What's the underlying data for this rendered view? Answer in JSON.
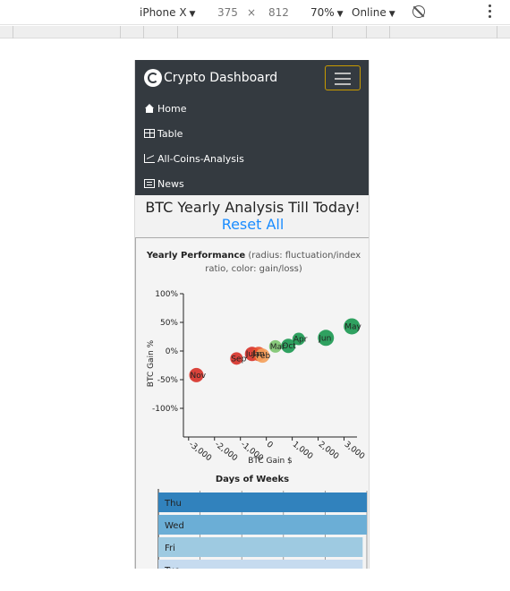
{
  "devtools": {
    "device": "iPhone X",
    "width": "375",
    "times": "×",
    "height": "812",
    "zoom": "70%",
    "network": "Online"
  },
  "nav": {
    "brand": "Crypto Dashboard",
    "links": [
      {
        "label": "Home",
        "icon": "home-icon"
      },
      {
        "label": "Table",
        "icon": "table-icon"
      },
      {
        "label": "All-Coins-Analysis",
        "icon": "chart-icon"
      },
      {
        "label": "News",
        "icon": "news-icon"
      }
    ]
  },
  "page": {
    "title": "BTC Yearly Analysis Till Today!",
    "reset": "Reset All"
  },
  "card": {
    "title": "Yearly Performance",
    "subtitle": " (radius: fluctuation/index ratio, color: gain/loss)"
  },
  "colors": {
    "navbar": "#343a40",
    "link": "#1a8cff",
    "toggler_border": "#c79a00"
  },
  "chart_data": [
    {
      "type": "scatter",
      "title": "Yearly Performance",
      "xlabel": "BTC Gain $",
      "ylabel": "BTC Gain %",
      "xlim": [
        -3200,
        3500
      ],
      "ylim": [
        -150,
        100
      ],
      "x_ticks": [
        "-3,000",
        "-2,000",
        "-1,000",
        "0",
        "1,000",
        "2,000",
        "3,000"
      ],
      "x_tick_values": [
        -3000,
        -2000,
        -1000,
        0,
        1000,
        2000,
        3000
      ],
      "y_ticks": [
        "100%",
        "50%",
        "0%",
        "-50%",
        "-100%"
      ],
      "y_tick_values": [
        100,
        50,
        0,
        -50,
        -100
      ],
      "points": [
        {
          "label": "Nov",
          "x": -2700,
          "y": -42,
          "r": 8,
          "color": "#d73027"
        },
        {
          "label": "Sep",
          "x": -1150,
          "y": -13,
          "r": 7,
          "color": "#d73027"
        },
        {
          "label": "Jul",
          "x": -550,
          "y": -5,
          "r": 8,
          "color": "#d73027"
        },
        {
          "label": "Jan",
          "x": -300,
          "y": -5,
          "r": 8,
          "color": "#e8502f"
        },
        {
          "label": "Feb",
          "x": -150,
          "y": -8,
          "r": 8,
          "color": "#f4a05a"
        },
        {
          "label": "Mar",
          "x": 350,
          "y": 8,
          "r": 7,
          "color": "#7cc46e"
        },
        {
          "label": "Oct",
          "x": 850,
          "y": 9,
          "r": 8,
          "color": "#1a9850"
        },
        {
          "label": "Apr",
          "x": 1250,
          "y": 21,
          "r": 7,
          "color": "#1a9850"
        },
        {
          "label": "Jun",
          "x": 2300,
          "y": 23,
          "r": 9,
          "color": "#1a9850"
        },
        {
          "label": "May",
          "x": 3300,
          "y": 43,
          "r": 9,
          "color": "#1a9850"
        }
      ]
    },
    {
      "type": "bar",
      "orientation": "horizontal",
      "title": "Days of Weeks",
      "categories": [
        "Thu",
        "Wed",
        "Fri",
        "Tue"
      ],
      "values": [
        100,
        100,
        98,
        98
      ],
      "colors": [
        "#3182bd",
        "#6baed6",
        "#9ecae1",
        "#c6dbef"
      ]
    }
  ]
}
